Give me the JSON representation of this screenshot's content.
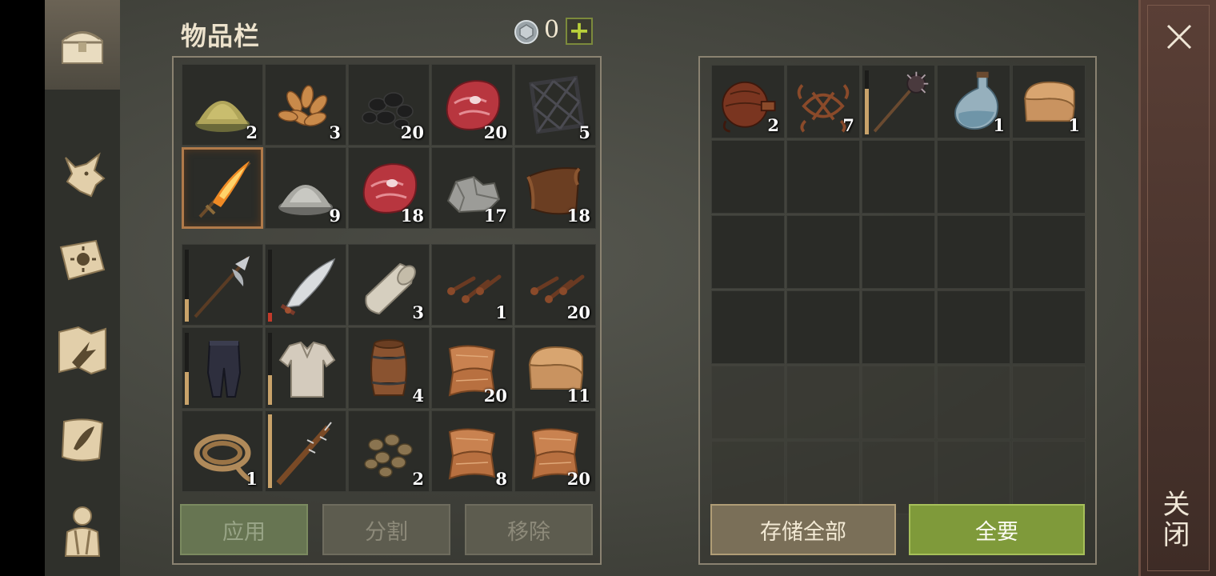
{
  "header": {
    "title": "物品栏",
    "coin_count": "0",
    "add_label": "+"
  },
  "inventory": {
    "grid_top": [
      {
        "item": "herb-powder",
        "qty": "2"
      },
      {
        "item": "seeds",
        "qty": "3"
      },
      {
        "item": "coal",
        "qty": "20"
      },
      {
        "item": "raw-meat",
        "qty": "20"
      },
      {
        "item": "iron-grate",
        "qty": "5"
      },
      {
        "item": "flaming-sword",
        "qty": "",
        "selected": true
      },
      {
        "item": "gray-powder",
        "qty": "9"
      },
      {
        "item": "raw-meat",
        "qty": "18"
      },
      {
        "item": "stone",
        "qty": "17"
      },
      {
        "item": "leather",
        "qty": "18"
      }
    ],
    "grid_bottom": [
      {
        "item": "halberd",
        "qty": "",
        "durability": 0.3
      },
      {
        "item": "scimitar",
        "qty": "",
        "durability": 0.12,
        "dur_color": "red"
      },
      {
        "item": "cloth-roll",
        "qty": "3"
      },
      {
        "item": "nails",
        "qty": "1"
      },
      {
        "item": "nails",
        "qty": "20"
      },
      {
        "item": "pants",
        "qty": "",
        "durability": 0.45
      },
      {
        "item": "shirt",
        "qty": "",
        "durability": 0.4
      },
      {
        "item": "barrel",
        "qty": "4"
      },
      {
        "item": "fabric",
        "qty": "20"
      },
      {
        "item": "folded-cloth",
        "qty": "11"
      },
      {
        "item": "rope",
        "qty": "1"
      },
      {
        "item": "spiked-club",
        "qty": "",
        "durability": 1.0
      },
      {
        "item": "stones",
        "qty": "2"
      },
      {
        "item": "fabric",
        "qty": "8"
      },
      {
        "item": "fabric",
        "qty": "20"
      }
    ],
    "buttons": {
      "apply": "应用",
      "split": "分割",
      "remove": "移除"
    }
  },
  "container": {
    "items": [
      {
        "item": "flask",
        "qty": "2"
      },
      {
        "item": "rope-net",
        "qty": "7"
      },
      {
        "item": "mace",
        "qty": "",
        "durability": 0.7
      },
      {
        "item": "potion-bottle",
        "qty": "1"
      },
      {
        "item": "folded-cloth",
        "qty": "1"
      }
    ],
    "buttons": {
      "store_all": "存储全部",
      "take_all": "全要"
    }
  },
  "close": {
    "label": "关闭"
  },
  "colors": {
    "accent_green": "#7f9a3a",
    "panel_border": "#8a8271",
    "durability": "#c9a36a"
  }
}
